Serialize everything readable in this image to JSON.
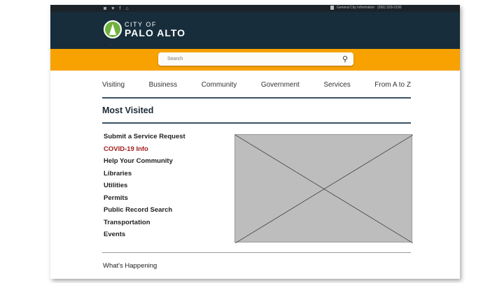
{
  "topbar": {
    "social_icons": [
      "instagram-icon",
      "twitter-icon",
      "facebook-icon",
      "nextdoor-icon"
    ],
    "info_label": "General City Information",
    "phone": "(650) 329-2100"
  },
  "logo": {
    "line1": "CITY OF",
    "line2": "PALO ALTO"
  },
  "search": {
    "placeholder": "Search"
  },
  "nav": [
    "Visiting",
    "Business",
    "Community",
    "Government",
    "Services",
    "From A to Z"
  ],
  "most_visited": {
    "title": "Most Visited",
    "links": [
      "Submit a Service Request",
      "COVID-19 Info",
      "Help Your Community",
      "Libraries",
      "Utilities",
      "Permits",
      "Public Record Search",
      "Transportation",
      "Events"
    ]
  },
  "section2": "What's Happening",
  "colors": {
    "header": "#172d3b",
    "accent": "#f7a200",
    "covid": "#a01b1b"
  }
}
